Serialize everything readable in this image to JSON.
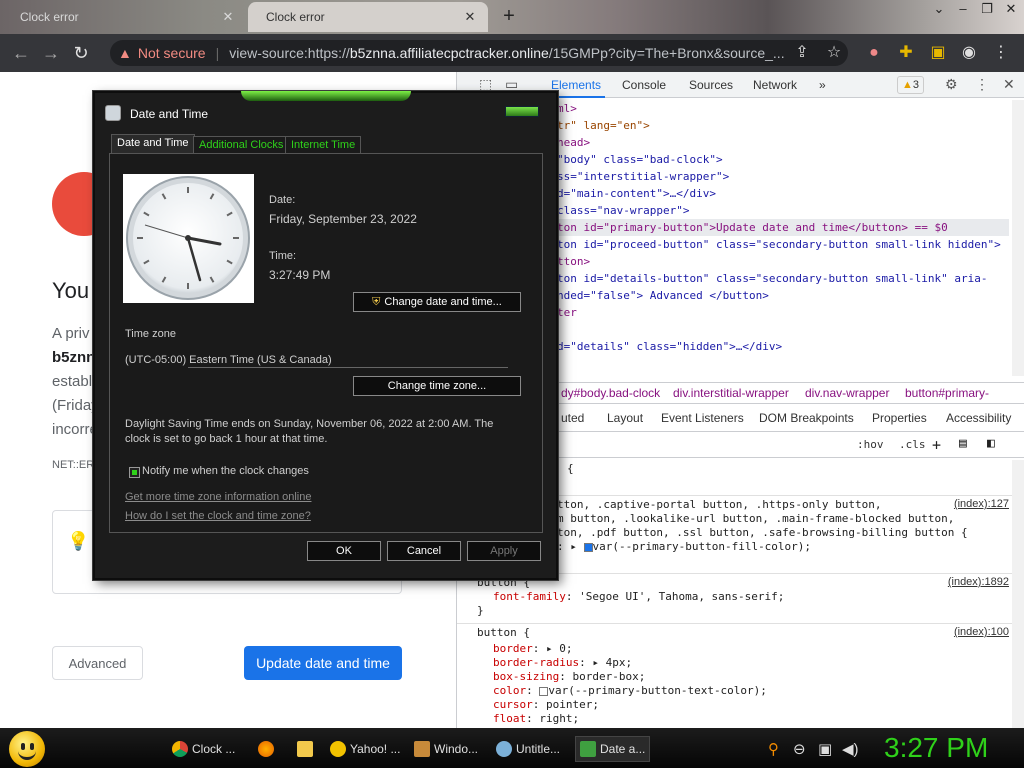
{
  "browser": {
    "tabs": [
      {
        "title": "Clock error",
        "active": false
      },
      {
        "title": "Clock error",
        "active": true
      }
    ],
    "new_tab": "+",
    "address": {
      "security_label": "Not secure",
      "url_prefix": "view-source:https://",
      "url_host": "b5znna.affiliatecpctracker.online",
      "url_rest": "/15GMPp?city=The+Bronx&source_..."
    },
    "warning_count": "3"
  },
  "page": {
    "heading": "You",
    "para_lines": [
      "A priv",
      "b5znn",
      "establ",
      "(Friday",
      "incorre"
    ],
    "error_code": "NET::ER",
    "advanced_label": "Advanced",
    "update_label": "Update date and time"
  },
  "devtools": {
    "tabs": [
      "Elements",
      "Console",
      "Sources",
      "Network",
      "»"
    ],
    "dom_lines": [
      {
        "pre": "",
        "text": "ml>"
      },
      {
        "pre": "",
        "text": "tr\" lang=\"en\">"
      },
      {
        "pre": "",
        "text": "head>"
      },
      {
        "pre": "",
        "text": "\"body\" class=\"bad-clock\">"
      },
      {
        "pre": "",
        "text": "ss=\"interstitial-wrapper\">"
      },
      {
        "pre": "",
        "text": "d=\"main-content\">…</div>"
      },
      {
        "pre": "",
        "text": "class=\"nav-wrapper\">"
      },
      {
        "pre": "",
        "text": "ton id=\"primary-button\">Update date and time</button> == $0"
      },
      {
        "pre": "",
        "text": "ton id=\"proceed-button\" class=\"secondary-button small-link hidden\">"
      },
      {
        "pre": "",
        "text": "tton>"
      },
      {
        "pre": "",
        "text": "ton id=\"details-button\" class=\"secondary-button small-link\" aria-"
      },
      {
        "pre": "",
        "text": "nded=\"false\"> Advanced </button>"
      },
      {
        "pre": "",
        "text": "ter"
      },
      {
        "pre": "",
        "text": ""
      },
      {
        "pre": "",
        "text": "d=\"details\" class=\"hidden\">…</div>"
      }
    ],
    "breadcrumbs": [
      "dy#body.bad-clock",
      "div.interstitial-wrapper",
      "div.nav-wrapper",
      "button#primary-"
    ],
    "styles_tabs": [
      "uted",
      "Layout",
      "Event Listeners",
      "DOM Breakpoints",
      "Properties",
      "Accessibility"
    ],
    "filter": {
      "hov": ":hov",
      "cls": ".cls",
      "plus": "+"
    },
    "rules": [
      {
        "selector_lines": [
          "{"
        ],
        "source": ""
      },
      {
        "selector_lines": [
          "tton, .captive-portal button, .https-only button,",
          "m button, .lookalike-url button, .main-frame-blocked button,",
          "ton, .pdf button, .ssl button, .safe-browsing-billing button {"
        ],
        "prop": "var(--primary-button-fill-color);",
        "source": "(index):127"
      },
      {
        "selector_lines": [
          "button {"
        ],
        "prop_name": "font-family",
        "prop_value": "'Segoe UI', Tahoma, sans-serif;",
        "source": "(index):1892"
      },
      {
        "selector_lines": [
          "button {"
        ],
        "source": "(index):100",
        "props": [
          {
            "name": "border",
            "value": "0;"
          },
          {
            "name": "border-radius",
            "value": "4px;"
          },
          {
            "name": "box-sizing",
            "value": "border-box;"
          },
          {
            "name": "color",
            "value": "var(--primary-button-text-color);"
          },
          {
            "name": "cursor",
            "value": "pointer;"
          },
          {
            "name": "float",
            "value": "right;"
          }
        ]
      }
    ]
  },
  "dialog": {
    "title": "Date and Time",
    "tabs": [
      "Date and Time",
      "Additional Clocks",
      "Internet Time"
    ],
    "date_label": "Date:",
    "date_value": "Friday, September 23, 2022",
    "time_label": "Time:",
    "time_value": "3:27:49 PM",
    "change_datetime_btn": "Change date and time...",
    "timezone_header": "Time zone",
    "timezone_value": "(UTC-05:00) Eastern Time (US & Canada)",
    "change_timezone_btn": "Change time zone...",
    "dst_line1": "Daylight Saving Time ends on Sunday, November 06, 2022 at 2:00 AM. The",
    "dst_line2": "clock is set to go back 1 hour at that time.",
    "notify_label": "Notify me when the clock changes",
    "link1": "Get more time zone information online",
    "link2": "How do I set the clock and time zone?",
    "ok": "OK",
    "cancel": "Cancel",
    "apply": "Apply"
  },
  "taskbar": {
    "items": [
      {
        "label": "Clock ...",
        "icon": "chrome-icon",
        "color": "#e8b000"
      },
      {
        "label": "",
        "icon": "firefox-icon",
        "color": "#e66000"
      },
      {
        "label": "",
        "icon": "folder-icon",
        "color": "#f2c94c"
      },
      {
        "label": "Yahoo! ...",
        "icon": "messenger-icon",
        "color": "#f2c200"
      },
      {
        "label": "Windo...",
        "icon": "media-player-icon",
        "color": "#c78a3a"
      },
      {
        "label": "Untitle...",
        "icon": "paint-icon",
        "color": "#7bb0d8"
      },
      {
        "label": "Date a...",
        "icon": "clock-icon",
        "color": "#3fa040"
      }
    ],
    "clock": "3:27 PM"
  }
}
